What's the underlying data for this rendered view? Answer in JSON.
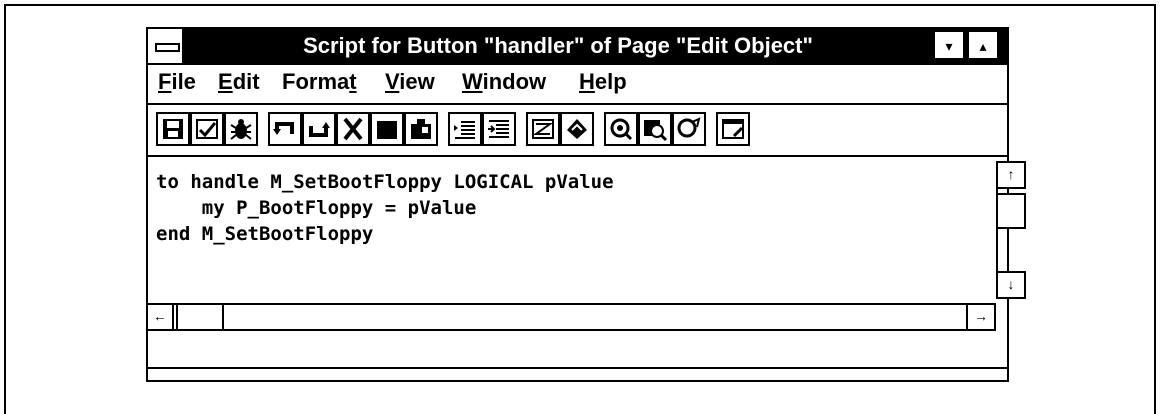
{
  "window": {
    "title": "Script for Button \"handler\" of Page \"Edit Object\"",
    "minimize_glyph": "▾",
    "maximize_glyph": "▴"
  },
  "menubar": {
    "file": {
      "mnemonic": "F",
      "rest": "ile"
    },
    "edit": {
      "mnemonic": "E",
      "rest": "dit"
    },
    "format": {
      "pre": "Forma",
      "mnemonic": "t"
    },
    "view": {
      "mnemonic": "V",
      "rest": "iew"
    },
    "window": {
      "mnemonic": "W",
      "rest": "indow"
    },
    "help": {
      "mnemonic": "H",
      "rest": "elp"
    }
  },
  "toolbar": {
    "icons": [
      "save-script-icon",
      "check-syntax-icon",
      "debug-bug-icon",
      "undo-icon",
      "redo-icon",
      "cut-icon",
      "copy-icon",
      "paste-icon",
      "indent-icon",
      "outdent-icon",
      "comment-icon",
      "find-icon",
      "search-icon",
      "find-next-icon",
      "replace-icon",
      "properties-icon"
    ]
  },
  "editor": {
    "lines": [
      "to handle M_SetBootFloppy LOGICAL pValue",
      "    my P_BootFloppy = pValue",
      "end M_SetBootFloppy"
    ]
  },
  "scroll": {
    "up": "↑",
    "down": "↓",
    "left": "←",
    "right": "→"
  }
}
